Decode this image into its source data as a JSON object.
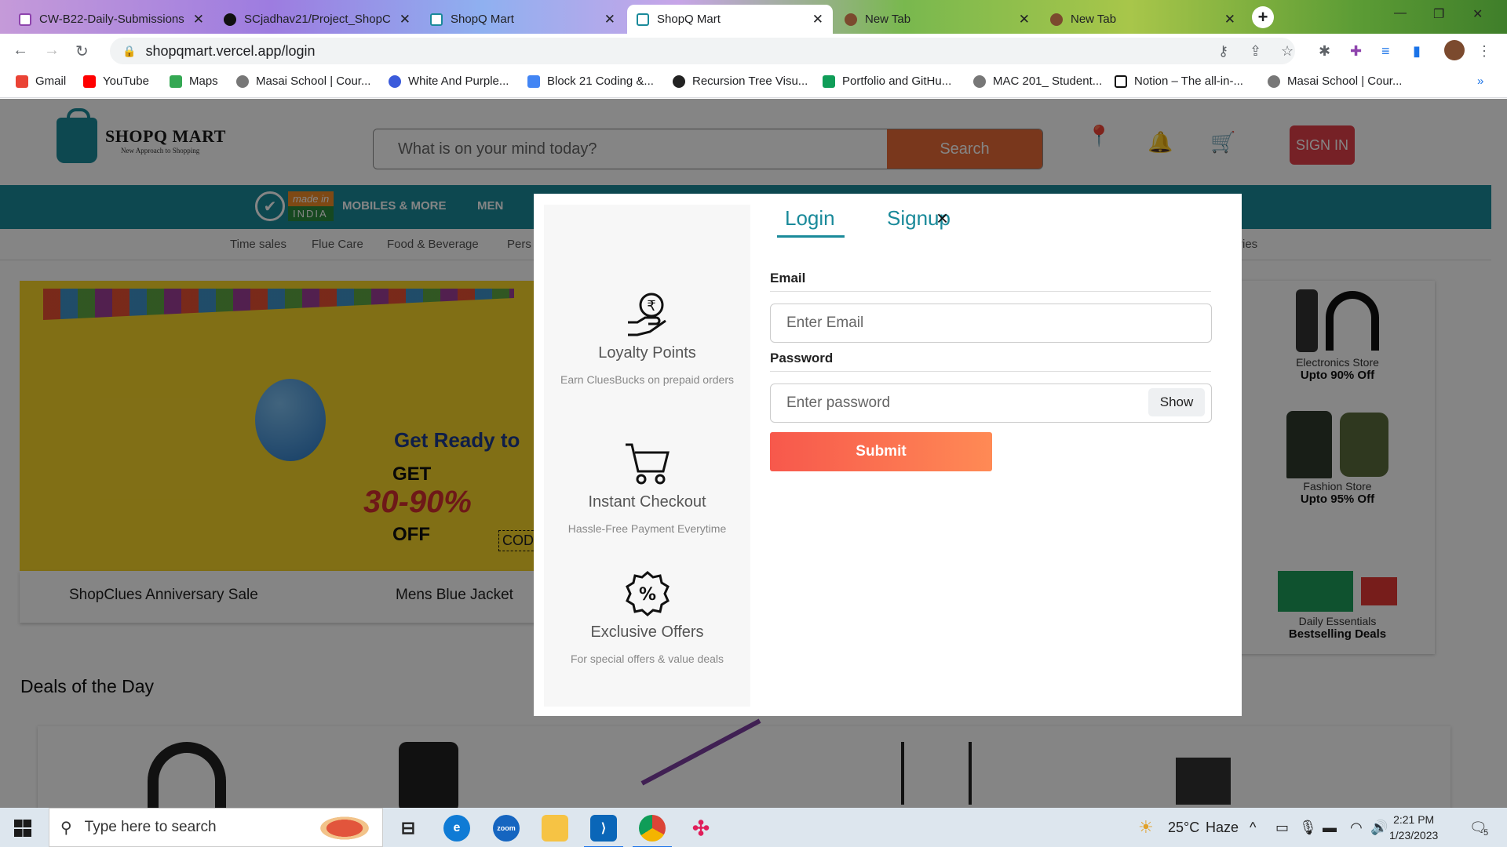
{
  "browser": {
    "tabs": [
      {
        "title": "CW-B22-Daily-Submissions",
        "active": false
      },
      {
        "title": "SCjadhav21/Project_ShopC",
        "active": false
      },
      {
        "title": "ShopQ Mart",
        "active": false
      },
      {
        "title": "ShopQ Mart",
        "active": true
      },
      {
        "title": "New Tab",
        "active": false
      },
      {
        "title": "New Tab",
        "active": false
      }
    ],
    "url": "shopqmart.vercel.app/login",
    "bookmarks": [
      {
        "label": "Gmail",
        "color": "#ea4335"
      },
      {
        "label": "YouTube",
        "color": "#ff0000"
      },
      {
        "label": "Maps",
        "color": "#34a853"
      },
      {
        "label": "Masai School | Cour...",
        "color": "#555555"
      },
      {
        "label": "White And Purple...",
        "color": "#3b5bdb"
      },
      {
        "label": "Block 21 Coding &...",
        "color": "#4285f4"
      },
      {
        "label": "Recursion Tree Visu...",
        "color": "#222222"
      },
      {
        "label": "Portfolio and GitHu...",
        "color": "#0f9d58"
      },
      {
        "label": "MAC 201_ Student...",
        "color": "#555555"
      },
      {
        "label": "Notion – The all-in-...",
        "color": "#111111"
      },
      {
        "label": "Masai School | Cour...",
        "color": "#555555"
      }
    ]
  },
  "site": {
    "logo_name": "SHOPQ MART",
    "logo_tagline": "New Approach to Shopping",
    "search_placeholder": "What is on your mind today?",
    "search_button": "Search",
    "signin_button": "SIGN IN",
    "made_in_l1": "made in",
    "made_in_l2": "INDIA",
    "categories": [
      "MOBILES & MORE",
      "MEN"
    ],
    "subnav": [
      "Time sales",
      "Flue Care",
      "Food & Beverage",
      "Pers",
      "ries"
    ],
    "banner": {
      "headline": "Get Ready to",
      "get": "GET",
      "percent": "30-90%",
      "off": "OFF",
      "code": "COD",
      "captions": [
        "ShopClues Anniversary Sale",
        "Mens Blue Jacket"
      ]
    },
    "stores": [
      {
        "name": "Electronics Store",
        "deal": "Upto 90% Off"
      },
      {
        "name": "Fashion Store",
        "deal": "Upto 95% Off"
      },
      {
        "name": "Daily Essentials",
        "deal": "Bestselling Deals"
      }
    ],
    "deals_title": "Deals of the Day"
  },
  "modal": {
    "features": [
      {
        "title": "Loyalty Points",
        "desc": "Earn CluesBucks on prepaid orders",
        "icon": "coin-hand-icon"
      },
      {
        "title": "Instant Checkout",
        "desc": "Hassle-Free Payment Everytime",
        "icon": "cart-icon"
      },
      {
        "title": "Exclusive Offers",
        "desc": "For special offers & value deals",
        "icon": "percent-badge-icon"
      }
    ],
    "tab_login": "Login",
    "tab_signup": "Signup",
    "close": "×",
    "email_label": "Email",
    "email_placeholder": "Enter Email",
    "password_label": "Password",
    "password_placeholder": "Enter password",
    "show_button": "Show",
    "submit_button": "Submit"
  },
  "taskbar": {
    "search_placeholder": "Type here to search",
    "weather_temp": "25°C",
    "weather_desc": "Haze",
    "time": "2:21 PM",
    "date": "1/23/2023",
    "notification_count": "5"
  },
  "colors": {
    "brand_teal": "#1a8a9a",
    "search_orange": "#e86a36",
    "signin_red": "#e3404a",
    "submit_gradient_start": "#f7584c",
    "submit_gradient_end": "#ff8a55"
  }
}
